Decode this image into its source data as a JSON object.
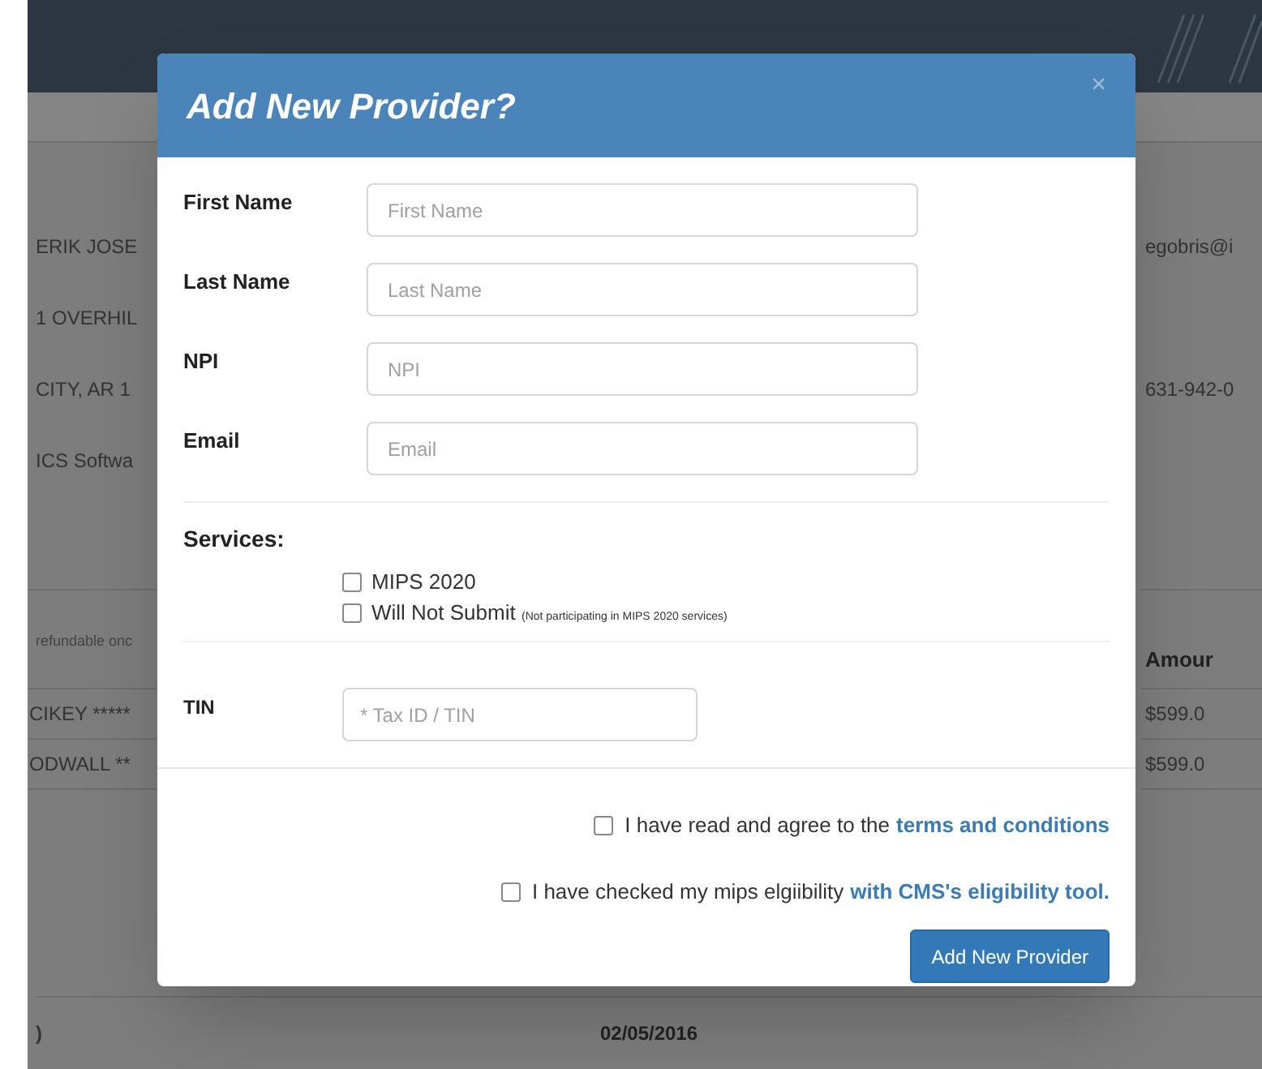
{
  "background": {
    "details": [
      "ERIK JOSE",
      "1 OVERHIL",
      "CITY, AR 1",
      "ICS Softwa"
    ],
    "email": "egobris@i",
    "phone": "631-942-0",
    "note": "refundable onc",
    "amount_header": "Amour",
    "table_rows": [
      {
        "column_1": "CIKEY *****",
        "column_2": "$599.0"
      },
      {
        "column_1": "ODWALL **",
        "column_2": "$599.0"
      }
    ],
    "footer_row": {
      "column_1": ")",
      "column_2": "02/05/2016"
    }
  },
  "modal": {
    "title": "Add New Provider?",
    "close": "×",
    "fields": [
      {
        "label": "First Name",
        "placeholder": "First Name"
      },
      {
        "label": "Last Name",
        "placeholder": "Last Name"
      },
      {
        "label": "NPI",
        "placeholder": "NPI"
      },
      {
        "label": "Email",
        "placeholder": "Email"
      }
    ],
    "services_label": "Services:",
    "services": [
      {
        "label": "MIPS 2020",
        "checked": false
      },
      {
        "label": "Will Not Submit",
        "note": "(Not participating in MIPS 2020 services)",
        "checked": false
      }
    ],
    "tin": {
      "label": "TIN",
      "placeholder": "* Tax ID / TIN"
    },
    "agreements": [
      {
        "text": "I have read and agree to the",
        "link": "terms and conditions",
        "checked": false
      },
      {
        "text": "I have checked my mips elgiibility",
        "link": "with CMS's eligibility tool.",
        "checked": false
      }
    ],
    "submit": "Add New Provider"
  }
}
